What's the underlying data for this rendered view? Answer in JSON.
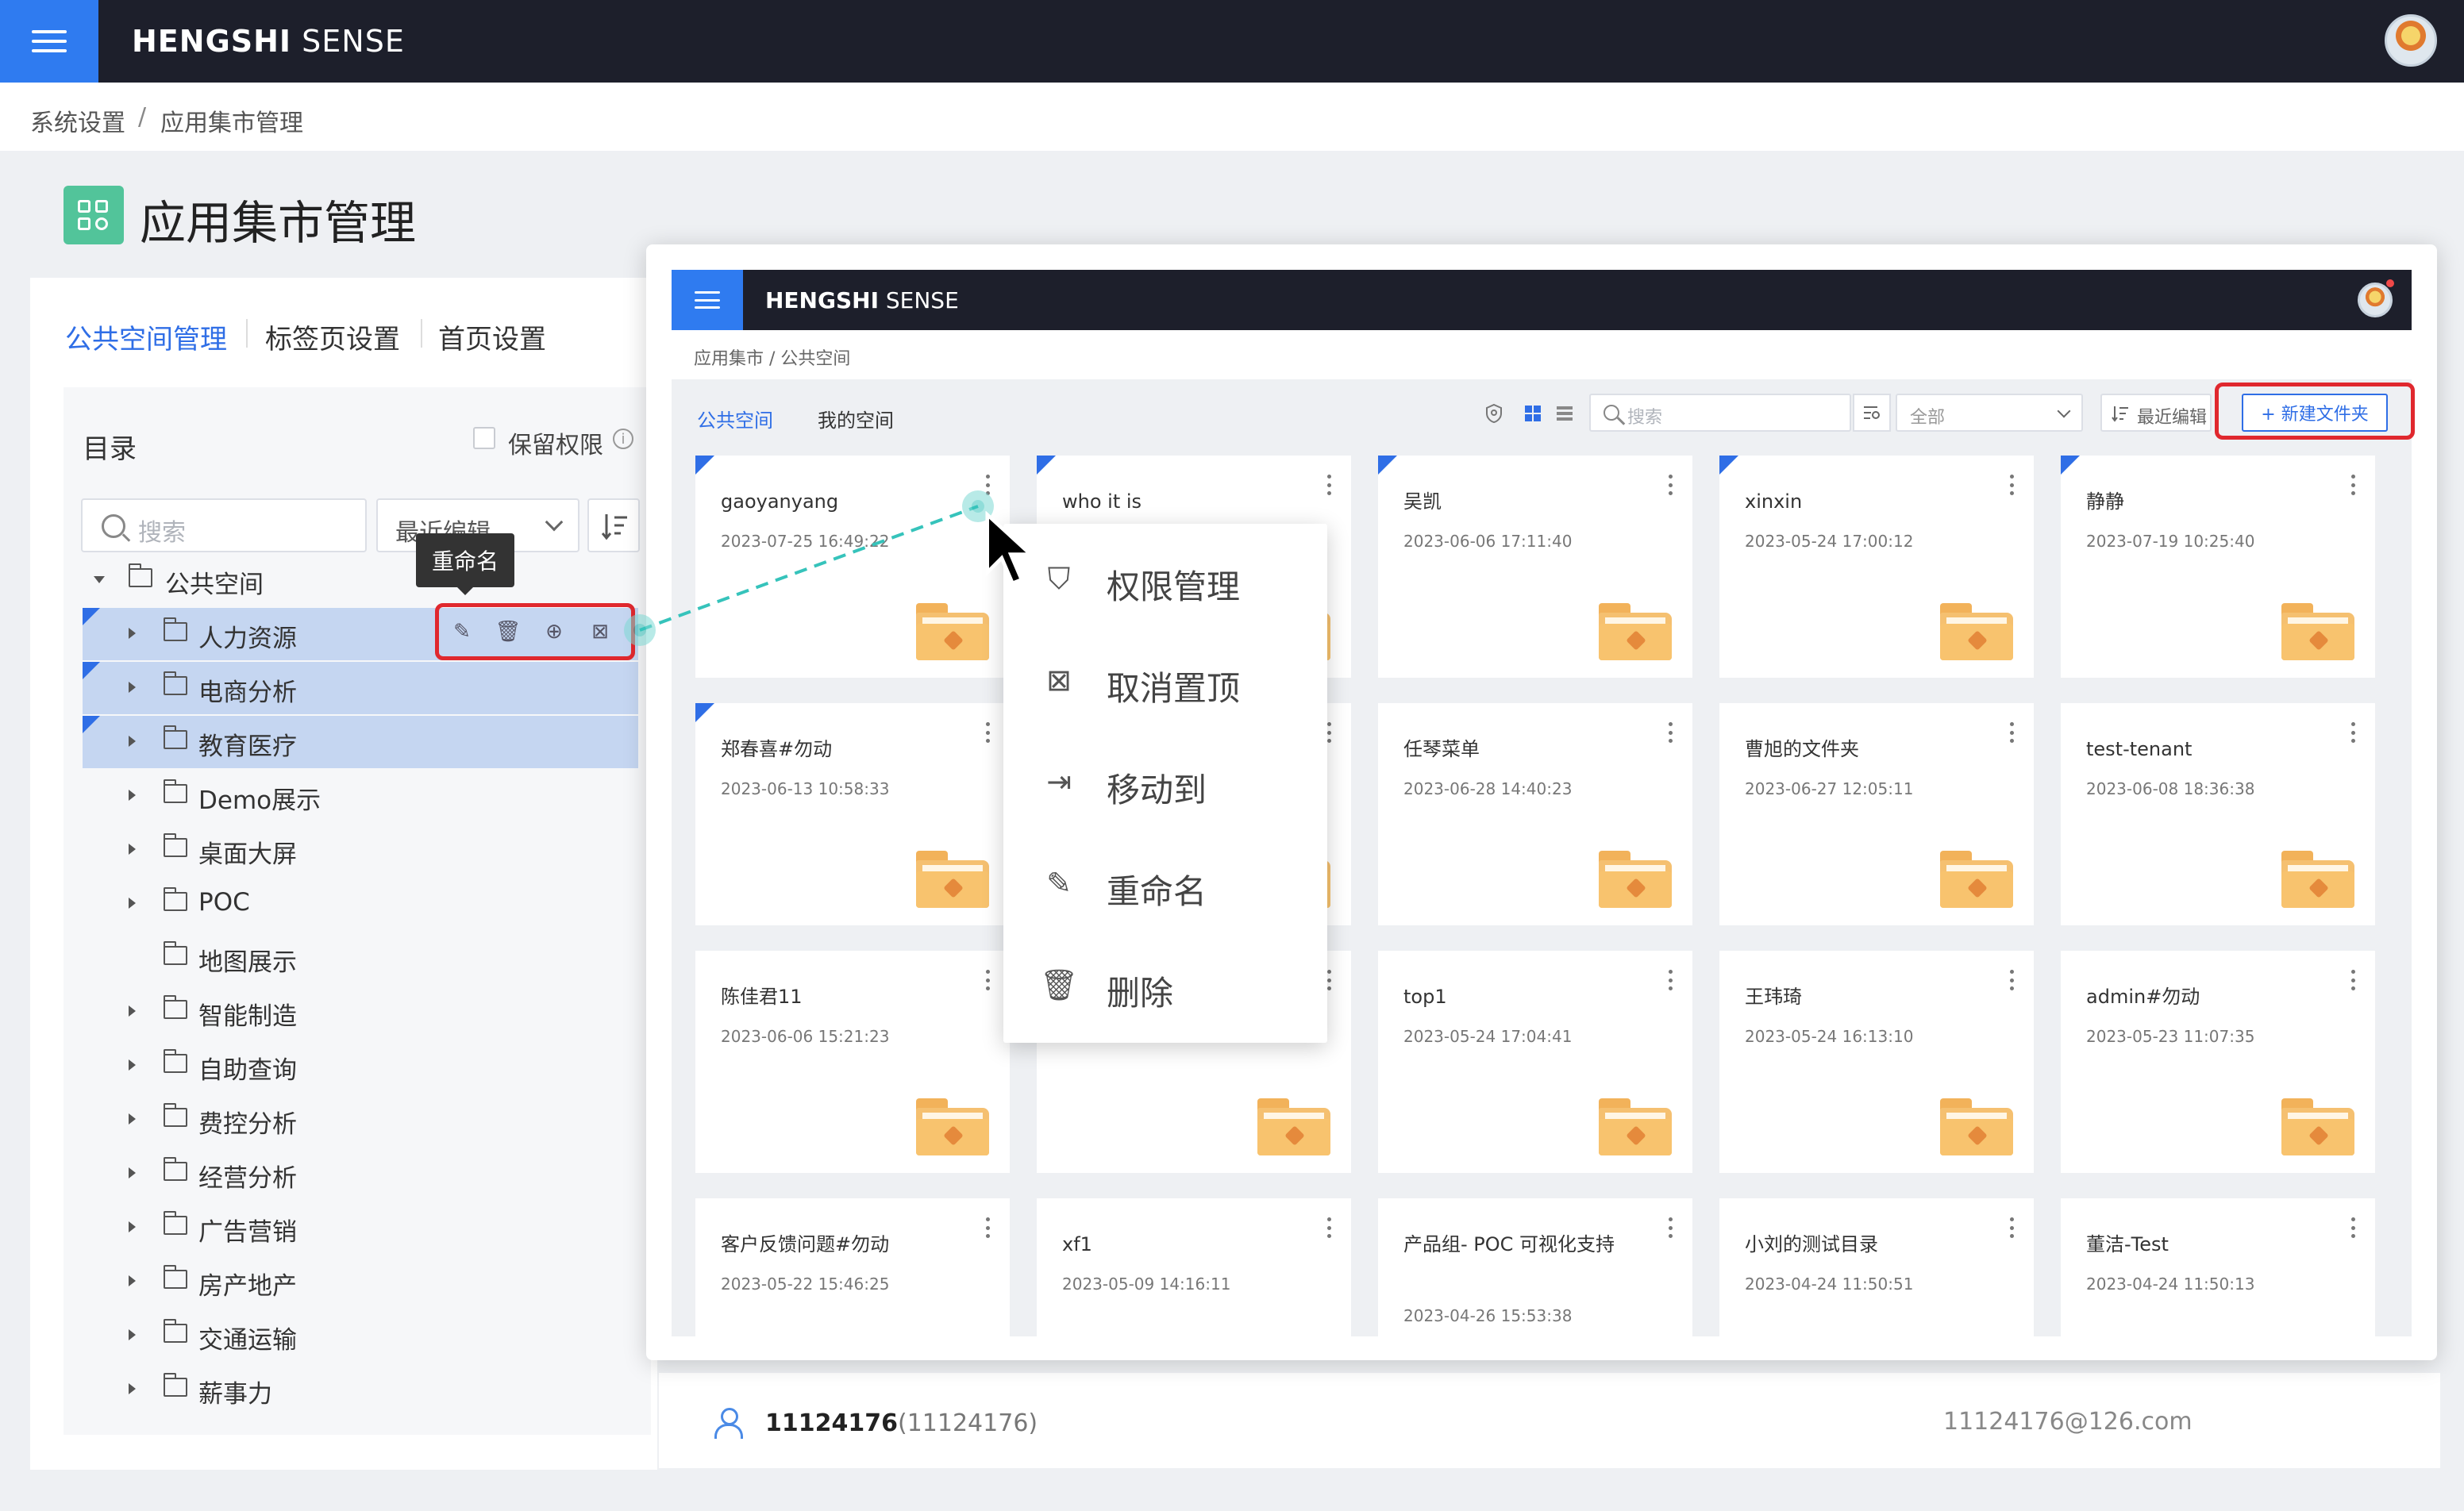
{
  "app": {
    "brand_bold": "HENGSHI",
    "brand_rest": " SENSE"
  },
  "breadcrumb": {
    "parent": "系统设置",
    "sep": "/",
    "current": "应用集市管理"
  },
  "page_title": "应用集市管理",
  "tabs": [
    {
      "label": "公共空间管理",
      "active": true
    },
    {
      "label": "标签页设置",
      "active": false
    },
    {
      "label": "首页设置",
      "active": false
    }
  ],
  "catalog": {
    "label": "目录",
    "keep_perm_label": "保留权限",
    "info_glyph": "i",
    "search_placeholder": "搜索",
    "sort_value": "最近编辑",
    "tooltip": "重命名",
    "root": "公共空间",
    "items": [
      {
        "label": "人力资源",
        "selected": true,
        "flag": true,
        "has_children": true
      },
      {
        "label": "电商分析",
        "selected": true,
        "flag": true,
        "has_children": true
      },
      {
        "label": "教育医疗",
        "selected": true,
        "flag": true,
        "has_children": true
      },
      {
        "label": "Demo展示",
        "selected": false,
        "flag": false,
        "has_children": true
      },
      {
        "label": "桌面大屏",
        "selected": false,
        "flag": false,
        "has_children": true
      },
      {
        "label": "POC",
        "selected": false,
        "flag": false,
        "has_children": true
      },
      {
        "label": "地图展示",
        "selected": false,
        "flag": false,
        "has_children": false
      },
      {
        "label": "智能制造",
        "selected": false,
        "flag": false,
        "has_children": true
      },
      {
        "label": "自助查询",
        "selected": false,
        "flag": false,
        "has_children": true
      },
      {
        "label": "费控分析",
        "selected": false,
        "flag": false,
        "has_children": true
      },
      {
        "label": "经营分析",
        "selected": false,
        "flag": false,
        "has_children": true
      },
      {
        "label": "广告营销",
        "selected": false,
        "flag": false,
        "has_children": true
      },
      {
        "label": "房产地产",
        "selected": false,
        "flag": false,
        "has_children": true
      },
      {
        "label": "交通运输",
        "selected": false,
        "flag": false,
        "has_children": true
      },
      {
        "label": "薪事力",
        "selected": false,
        "flag": false,
        "has_children": true
      }
    ],
    "row_action_icons": [
      "edit-icon",
      "trash-icon",
      "add-circle-icon",
      "unpin-icon"
    ]
  },
  "user": {
    "id": "11124176",
    "paren": "(11124176)",
    "email": "11124176@126.com"
  },
  "overlay": {
    "breadcrumb": "应用集市  /  公共空间",
    "tabs": [
      {
        "label": "公共空间",
        "active": true
      },
      {
        "label": "我的空间",
        "active": false
      }
    ],
    "search_placeholder": "搜索",
    "filter_value": "全部",
    "sort_value": "最近编辑",
    "new_folder_label": "+  新建文件夹",
    "cards": [
      {
        "title": "gaoyanyang",
        "date": "2023-07-25 16:49:22",
        "flag": true
      },
      {
        "title": "who it is",
        "date": "",
        "flag": true
      },
      {
        "title": "吴凯",
        "date": "2023-06-06 17:11:40",
        "flag": true
      },
      {
        "title": "xinxin",
        "date": "2023-05-24 17:00:12",
        "flag": true
      },
      {
        "title": "静静",
        "date": "2023-07-19 10:25:40",
        "flag": true
      },
      {
        "title": "郑春喜#勿动",
        "date": "2023-06-13 10:58:33",
        "flag": true
      },
      {
        "title": "",
        "date": "",
        "flag": false
      },
      {
        "title": "任琴菜单",
        "date": "2023-06-28 14:40:23",
        "flag": false
      },
      {
        "title": "曹旭的文件夹",
        "date": "2023-06-27 12:05:11",
        "flag": false
      },
      {
        "title": "test-tenant",
        "date": "2023-06-08 18:36:38",
        "flag": false
      },
      {
        "title": "陈佳君11",
        "date": "2023-06-06 15:21:23",
        "flag": false
      },
      {
        "title": "",
        "date": "",
        "flag": false
      },
      {
        "title": "top1",
        "date": "2023-05-24 17:04:41",
        "flag": false
      },
      {
        "title": "王玮琦",
        "date": "2023-05-24 16:13:10",
        "flag": false
      },
      {
        "title": "admin#勿动",
        "date": "2023-05-23 11:07:35",
        "flag": false
      },
      {
        "title": "客户反馈问题#勿动",
        "date": "2023-05-22 15:46:25",
        "flag": false
      },
      {
        "title": "xf1",
        "date": "2023-05-09 14:16:11",
        "flag": false
      },
      {
        "title": "产品组- POC 可视化支持",
        "date": "2023-04-26 15:53:38",
        "flag": false
      },
      {
        "title": "小刘的测试目录",
        "date": "2023-04-24 11:50:51",
        "flag": false
      },
      {
        "title": "董洁-Test",
        "date": "2023-04-24 11:50:13",
        "flag": false
      }
    ],
    "context_menu": [
      {
        "label": "权限管理",
        "icon": "shield-icon"
      },
      {
        "label": "取消置顶",
        "icon": "unpin-icon"
      },
      {
        "label": "移动到",
        "icon": "move-icon"
      },
      {
        "label": "重命名",
        "icon": "edit-icon"
      },
      {
        "label": "删除",
        "icon": "trash-icon"
      }
    ]
  },
  "colors": {
    "accent": "#2f6ee6",
    "header": "#1d1f2b",
    "highlight": "#e0282e",
    "selected_row": "#c5d6f1",
    "folder": "#f5c070",
    "connector": "#36c3bb"
  }
}
